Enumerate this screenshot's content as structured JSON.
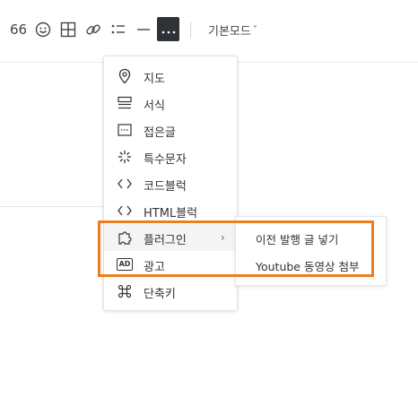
{
  "toolbar": {
    "quote_icon": "quote-icon",
    "emoji_icon": "emoji-icon",
    "table_icon": "table-icon",
    "link_icon": "link-icon",
    "list_icon": "list-icon",
    "divider_icon": "horizontal-rule-icon",
    "more_icon": "more-icon",
    "mode_label": "기본모드",
    "mode_chevron": "˅"
  },
  "menu": {
    "items": [
      {
        "label": "지도",
        "icon": "map-pin-icon"
      },
      {
        "label": "서식",
        "icon": "template-icon"
      },
      {
        "label": "접은글",
        "icon": "fold-icon"
      },
      {
        "label": "특수문자",
        "icon": "special-char-icon"
      },
      {
        "label": "코드블럭",
        "icon": "code-icon"
      },
      {
        "label": "HTML블럭",
        "icon": "html-icon"
      },
      {
        "label": "플러그인",
        "icon": "plugin-icon",
        "chevron": "›"
      },
      {
        "label": "광고",
        "icon": "ad-icon",
        "badge": "AD"
      },
      {
        "label": "단축키",
        "icon": "shortcut-icon"
      }
    ]
  },
  "submenu": {
    "items": [
      {
        "label": "이전 발행 글 넣기"
      },
      {
        "label": "Youtube 동영상 첨부"
      }
    ]
  },
  "colors": {
    "highlight": "#ee7d1e",
    "more_bg": "#2f3338"
  }
}
